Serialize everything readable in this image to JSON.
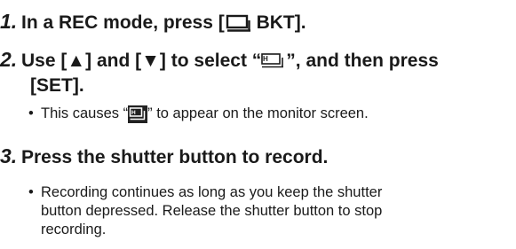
{
  "steps": [
    {
      "number": "1.",
      "text_before": "In a REC mode, press [",
      "icon": "continuous-shooting-icon",
      "text_after": " BKT]."
    },
    {
      "number": "2.",
      "line1_before": "Use [▲] and [▼] to select “",
      "icon": "high-speed-continuous-icon",
      "line1_after": "”, and then press",
      "line2": "[SET].",
      "bullet": {
        "before": "This causes “",
        "icon": "high-speed-continuous-inverted-icon",
        "after": "” to appear on the monitor screen."
      }
    },
    {
      "number": "3.",
      "text": "Press the shutter button to record.",
      "bullet_lines": [
        "Recording continues as long as you keep the shutter",
        "button depressed. Release the shutter button to stop",
        "recording."
      ]
    }
  ],
  "bullet_char": "•"
}
